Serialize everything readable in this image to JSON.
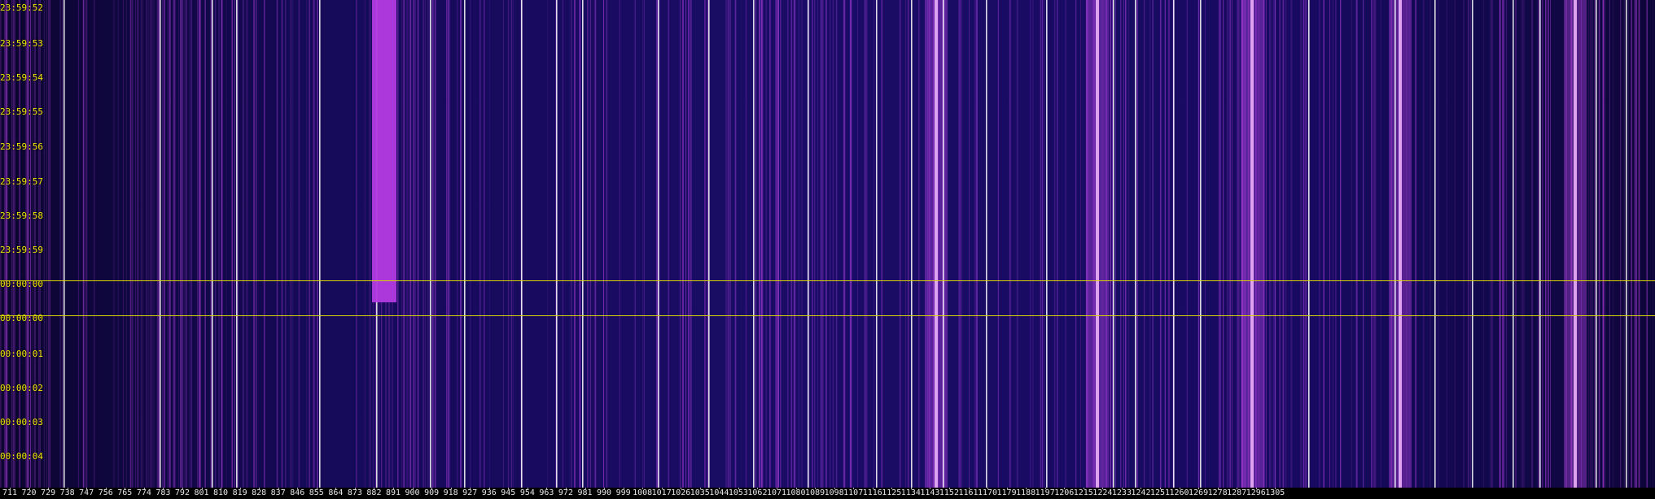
{
  "spectrogram": {
    "time_labels": [
      "23:59:52",
      "23:59:53",
      "23:59:54",
      "23:59:55",
      "23:59:56",
      "23:59:57",
      "23:59:58",
      "23:59:59",
      "00:00:00",
      "00:00:00",
      "00:00:01",
      "00:00:02",
      "00:00:03",
      "00:00:04"
    ],
    "marker_labels": [
      "00:00:00",
      "00:00:00"
    ],
    "frequency_labels": [
      "711",
      "720",
      "729",
      "738",
      "747",
      "756",
      "765",
      "774",
      "783",
      "792",
      "801",
      "810",
      "819",
      "828",
      "837",
      "846",
      "855",
      "864",
      "873",
      "882",
      "891",
      "900",
      "909",
      "918",
      "927",
      "936",
      "945",
      "954",
      "963",
      "972",
      "981",
      "990",
      "999",
      "1008",
      "1017",
      "1026",
      "1035",
      "1044",
      "1053",
      "1062",
      "1071",
      "1080",
      "1089",
      "1098",
      "1107",
      "1116",
      "1125",
      "1134",
      "1143",
      "1152",
      "1161",
      "1170",
      "1179",
      "1188",
      "1197",
      "1206",
      "1215",
      "1224",
      "1233",
      "1242",
      "1251",
      "1260",
      "1269",
      "1278",
      "1287",
      "1296",
      "1305"
    ],
    "colors": {
      "background": "#17095a",
      "signal": "#d04cff",
      "strong_signal": "#ffffff",
      "marker": "#d9d400",
      "time_text": "#f2e600",
      "freq_text": "#e9e9e9"
    }
  }
}
